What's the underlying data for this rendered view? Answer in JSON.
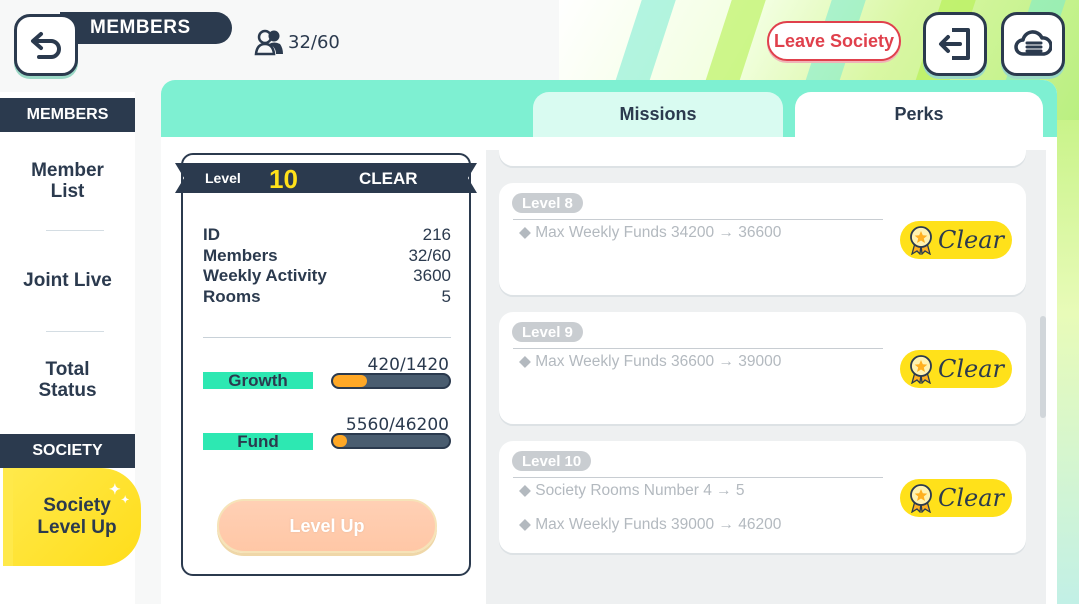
{
  "header": {
    "title": "MEMBERS",
    "member_count": "32/60",
    "leave_button": "Leave Society"
  },
  "sidebar": {
    "section_members": "MEMBERS",
    "items": [
      {
        "label": "Member\nList"
      },
      {
        "label": "Joint Live"
      },
      {
        "label": "Total\nStatus"
      }
    ],
    "section_society": "SOCIETY",
    "active_item": "Society\nLevel Up"
  },
  "tabs": {
    "missions": "Missions",
    "perks": "Perks",
    "selected": "Perks"
  },
  "level_card": {
    "level_label": "Level",
    "level_number": "10",
    "status": "CLEAR",
    "stats": [
      {
        "label": "ID",
        "value": "216"
      },
      {
        "label": "Members",
        "value": "32/60"
      },
      {
        "label": "Weekly Activity",
        "value": "3600"
      },
      {
        "label": "Rooms",
        "value": "5"
      }
    ],
    "growth": {
      "label": "Growth",
      "value": "420/1420",
      "fraction": 0.2958
    },
    "fund": {
      "label": "Fund",
      "value": "5560/46200",
      "fraction": 0.1203
    },
    "level_up_button": "Level Up"
  },
  "perks": [
    {
      "level": "Level 8",
      "lines": [
        "◆ Max Weekly Funds 34200 → 36600"
      ],
      "badge": "Clear"
    },
    {
      "level": "Level 9",
      "lines": [
        "◆ Max Weekly Funds 36600 → 39000"
      ],
      "badge": "Clear"
    },
    {
      "level": "Level 10",
      "lines": [
        "◆ Society Rooms Number 4 → 5",
        "◆ Max Weekly Funds 39000 → 46200"
      ],
      "badge": "Clear"
    }
  ],
  "icons": {
    "back": "back-arrow-icon",
    "members": "members-icon",
    "exit": "exit-icon",
    "cloud": "cloud-menu-icon",
    "badge": "ribbon-medal-icon"
  },
  "colors": {
    "navy": "#2b3a4e",
    "mint": "#7ef0d2",
    "yellow": "#ffe11a",
    "orange": "#ffa826",
    "red": "#e0404c"
  }
}
